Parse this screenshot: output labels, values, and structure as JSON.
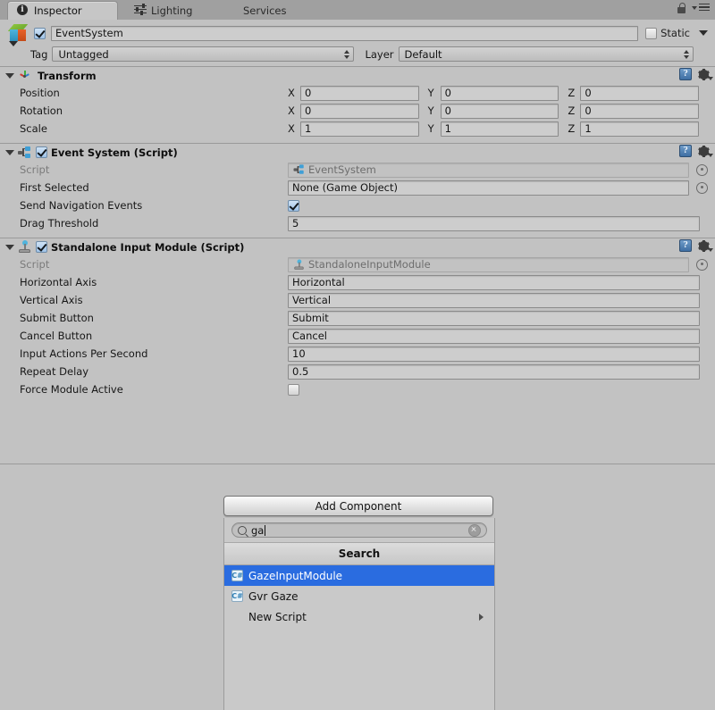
{
  "window": {
    "tabs": [
      {
        "label": "Inspector",
        "icon": "info-icon",
        "active": true
      },
      {
        "label": "Lighting",
        "icon": "sliders-icon",
        "active": false
      },
      {
        "label": "Services",
        "icon": "none",
        "active": false
      }
    ],
    "lock_icon": "lock-icon",
    "menu_icon": "hamburger-menu-icon"
  },
  "game_object": {
    "enabled": true,
    "name": "EventSystem",
    "icon": "gameobject-cube-icon",
    "static_label": "Static",
    "static_checked": false,
    "tag_label": "Tag",
    "tag_value": "Untagged",
    "layer_label": "Layer",
    "layer_value": "Default"
  },
  "components": [
    {
      "title": "Transform",
      "icon": "transform-axis-icon",
      "has_enable_checkbox": false,
      "expanded": true,
      "rows": [
        {
          "type": "vector3",
          "label": "Position",
          "axes": [
            "X",
            "Y",
            "Z"
          ],
          "values": [
            "0",
            "0",
            "0"
          ]
        },
        {
          "type": "vector3",
          "label": "Rotation",
          "axes": [
            "X",
            "Y",
            "Z"
          ],
          "values": [
            "0",
            "0",
            "0"
          ]
        },
        {
          "type": "vector3",
          "label": "Scale",
          "axes": [
            "X",
            "Y",
            "Z"
          ],
          "values": [
            "1",
            "1",
            "1"
          ]
        }
      ]
    },
    {
      "title": "Event System (Script)",
      "icon": "event-system-icon",
      "has_enable_checkbox": true,
      "enabled": true,
      "expanded": true,
      "rows": [
        {
          "type": "object",
          "label": "Script",
          "value": "EventSystem",
          "disabled": true,
          "value_icon": "event-system-icon"
        },
        {
          "type": "object",
          "label": "First Selected",
          "value": "None (Game Object)",
          "disabled": false
        },
        {
          "type": "checkbox",
          "label": "Send Navigation Events",
          "checked": true
        },
        {
          "type": "text",
          "label": "Drag Threshold",
          "value": "5"
        }
      ]
    },
    {
      "title": "Standalone Input Module (Script)",
      "icon": "joystick-icon",
      "has_enable_checkbox": true,
      "enabled": true,
      "expanded": true,
      "rows": [
        {
          "type": "object",
          "label": "Script",
          "value": "StandaloneInputModule",
          "disabled": true,
          "value_icon": "joystick-icon"
        },
        {
          "type": "text",
          "label": "Horizontal Axis",
          "value": "Horizontal"
        },
        {
          "type": "text",
          "label": "Vertical Axis",
          "value": "Vertical"
        },
        {
          "type": "text",
          "label": "Submit Button",
          "value": "Submit"
        },
        {
          "type": "text",
          "label": "Cancel Button",
          "value": "Cancel"
        },
        {
          "type": "text",
          "label": "Input Actions Per Second",
          "value": "10"
        },
        {
          "type": "text",
          "label": "Repeat Delay",
          "value": "0.5"
        },
        {
          "type": "checkbox",
          "label": "Force Module Active",
          "checked": false
        }
      ]
    }
  ],
  "add_component": {
    "button_label": "Add Component",
    "search_value": "ga",
    "search_placeholder": "",
    "search_icon": "magnifier-icon",
    "clear_icon": "clear-circle-icon",
    "list_header": "Search",
    "results": [
      {
        "label": "GazeInputModule",
        "icon": "csharp-script-icon",
        "selected": true,
        "submenu": false
      },
      {
        "label": "Gvr Gaze",
        "icon": "csharp-script-icon",
        "selected": false,
        "submenu": false
      },
      {
        "label": "New Script",
        "icon": "none",
        "selected": false,
        "submenu": true
      }
    ]
  },
  "colors": {
    "background": "#c2c2c2",
    "tabbar": "#a0a0a0",
    "selection": "#2a6ce0",
    "field": "#cdcdcd",
    "border": "#8b8b8b"
  }
}
